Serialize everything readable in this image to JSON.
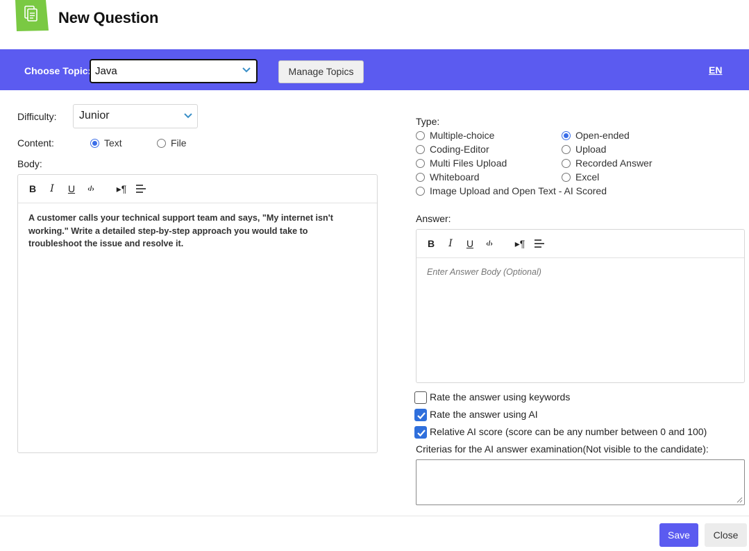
{
  "header": {
    "title": "New Question",
    "logo_icon": "document-copy-icon"
  },
  "topic_bar": {
    "label": "Choose Topic:",
    "selected_topic": "Java",
    "manage_button": "Manage Topics",
    "language": "EN",
    "background_color": "#5b5bf0"
  },
  "difficulty": {
    "label": "Difficulty:",
    "value": "Junior"
  },
  "content": {
    "label": "Content:",
    "options": [
      {
        "label": "Text",
        "checked": true
      },
      {
        "label": "File",
        "checked": false
      }
    ]
  },
  "body": {
    "label": "Body:",
    "text": "A customer calls your technical support team and says, \"My internet isn't working.\" Write a detailed step-by-step approach you would take to troubleshoot the issue and resolve it."
  },
  "type": {
    "label": "Type:",
    "options": [
      {
        "label": "Multiple-choice",
        "checked": false
      },
      {
        "label": "Open-ended",
        "checked": true
      },
      {
        "label": "Coding-Editor",
        "checked": false
      },
      {
        "label": "Upload",
        "checked": false
      },
      {
        "label": "Multi Files Upload",
        "checked": false
      },
      {
        "label": "Recorded Answer",
        "checked": false
      },
      {
        "label": "Whiteboard",
        "checked": false
      },
      {
        "label": "Excel",
        "checked": false
      },
      {
        "label": "Image Upload and Open Text - AI Scored",
        "checked": false
      }
    ]
  },
  "answer": {
    "label": "Answer:",
    "placeholder": "Enter Answer Body (Optional)"
  },
  "toolbar": {
    "bold": "B",
    "italic": "I",
    "underline": "U",
    "code": "‹/›",
    "paragraph": "▸¶",
    "align": "align-left-icon"
  },
  "checkboxes": [
    {
      "label": "Rate the answer using keywords",
      "checked": false
    },
    {
      "label": "Rate the answer using AI",
      "checked": true
    },
    {
      "label": "Relative AI score (score can be any number between 0 and 100)",
      "checked": true
    }
  ],
  "criteria": {
    "label": "Criterias for the AI answer examination(Not visible to the candidate):",
    "value": ""
  },
  "footer": {
    "save": "Save",
    "close": "Close",
    "accent_color": "#5b5bf0"
  }
}
